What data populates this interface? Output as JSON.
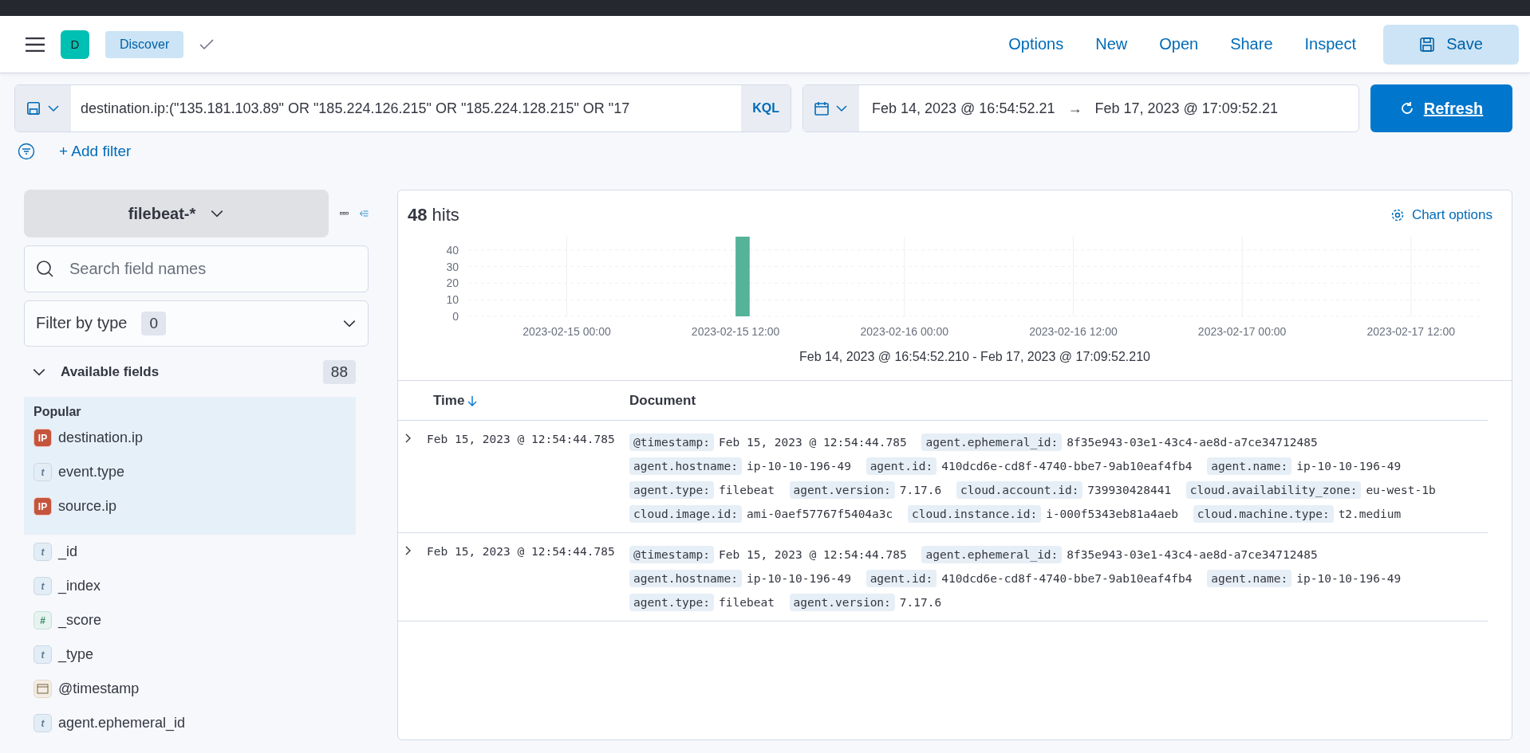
{
  "header": {
    "avatar": "D",
    "app": "Discover",
    "links": [
      "Options",
      "New",
      "Open",
      "Share",
      "Inspect"
    ],
    "save": "Save"
  },
  "query": {
    "value": "destination.ip:(\"135.181.103.89\" OR \"185.224.126.215\" OR \"185.224.128.215\" OR \"17",
    "language": "KQL",
    "start": "Feb 14, 2023 @ 16:54:52.21",
    "arrow": "→",
    "end": "Feb 17, 2023 @ 17:09:52.21",
    "refresh": "Refresh"
  },
  "add_filter": "+ Add filter",
  "sidebar": {
    "index_pattern": "filebeat-*",
    "search": {
      "placeholder": "Search field names"
    },
    "filter_label": "Filter by type",
    "filter_count": "0",
    "available_label": "Available fields",
    "available_count": "88",
    "expanded": true,
    "popular_label": "Popular",
    "popular": [
      {
        "name": "destination.ip",
        "kind": "ip",
        "token": "IP"
      },
      {
        "name": "event.type",
        "kind": "string",
        "token": "t"
      },
      {
        "name": "source.ip",
        "kind": "ip",
        "token": "IP"
      }
    ],
    "fields": [
      {
        "name": "_id",
        "kind": "string",
        "token": "t"
      },
      {
        "name": "_index",
        "kind": "string",
        "token": "t"
      },
      {
        "name": "_score",
        "kind": "number",
        "token": "#"
      },
      {
        "name": "_type",
        "kind": "string",
        "token": "t"
      },
      {
        "name": "@timestamp",
        "kind": "date"
      },
      {
        "name": "agent.ephemeral_id",
        "kind": "string",
        "token": "t"
      }
    ]
  },
  "results": {
    "hits": "48",
    "hits_label": "hits",
    "chart_options": "Chart options",
    "chart_data": {
      "type": "bar",
      "xlabel": "Feb 14, 2023 @ 16:54:52.210 - Feb 17, 2023 @ 17:09:52.210",
      "ylim": [
        0,
        48
      ],
      "grid": true,
      "categories": [
        null,
        null,
        null,
        null,
        null,
        null,
        null,
        "2023-02-15 00:00",
        null,
        null,
        null,
        null,
        null,
        null,
        null,
        null,
        null,
        null,
        null,
        "2023-02-15 12:00",
        null,
        null,
        null,
        null,
        null,
        null,
        null,
        null,
        null,
        null,
        null,
        "2023-02-16 00:00",
        null,
        null,
        null,
        null,
        null,
        null,
        null,
        null,
        null,
        null,
        null,
        "2023-02-16 12:00",
        null,
        null,
        null,
        null,
        null,
        null,
        null,
        null,
        null,
        null,
        null,
        "2023-02-17 00:00",
        null,
        null,
        null,
        null,
        null,
        null,
        null,
        null,
        null,
        null,
        null,
        "2023-02-17 12:00",
        null,
        null,
        null,
        null
      ],
      "yticks": [
        0,
        10,
        20,
        30,
        40
      ],
      "series": [
        {
          "color": "#54b399",
          "values": [
            0,
            0,
            0,
            0,
            0,
            0,
            0,
            0,
            0,
            0,
            0,
            0,
            0,
            0,
            0,
            0,
            0,
            0,
            0,
            48,
            0,
            0,
            0,
            0,
            0,
            0,
            0,
            0,
            0,
            0,
            0,
            0,
            0,
            0,
            0,
            0,
            0,
            0,
            0,
            0,
            0,
            0,
            0,
            0,
            0,
            0,
            0,
            0,
            0,
            0,
            0,
            0,
            0,
            0,
            0,
            0,
            0,
            0,
            0,
            0,
            0,
            0,
            0,
            0,
            0,
            0,
            0,
            0,
            0,
            0,
            0,
            0
          ]
        }
      ]
    },
    "columns": [
      {
        "label": "Time",
        "sorted": true
      },
      {
        "label": "Document",
        "sorted": false
      }
    ],
    "rows": [
      {
        "expanded": false,
        "time": "Feb 15, 2023 @ 12:54:44.785",
        "fields": [
          {
            "key": "@timestamp:",
            "value": "Feb 15, 2023 @ 12:54:44.785"
          },
          {
            "key": "agent.ephemeral_id:",
            "value": "8f35e943-03e1-43c4-ae8d-a7ce34712485"
          },
          {
            "key": "agent.hostname:",
            "value": "ip-10-10-196-49"
          },
          {
            "key": "agent.id:",
            "value": "410dcd6e-cd8f-4740-bbe7-9ab10eaf4fb4"
          },
          {
            "key": "agent.name:",
            "value": "ip-10-10-196-49"
          },
          {
            "key": "agent.type:",
            "value": "filebeat"
          },
          {
            "key": "agent.version:",
            "value": "7.17.6"
          },
          {
            "key": "cloud.account.id:",
            "value": "739930428441"
          },
          {
            "key": "cloud.availability_zone:",
            "value": "eu-west-1b"
          },
          {
            "key": "cloud.image.id:",
            "value": "ami-0aef57767f5404a3c"
          },
          {
            "key": "cloud.instance.id:",
            "value": "i-000f5343eb81a4aeb"
          },
          {
            "key": "cloud.machine.type:",
            "value": "t2.medium"
          }
        ]
      },
      {
        "expanded": false,
        "time": "Feb 15, 2023 @ 12:54:44.785",
        "fields": [
          {
            "key": "@timestamp:",
            "value": "Feb 15, 2023 @ 12:54:44.785"
          },
          {
            "key": "agent.ephemeral_id:",
            "value": "8f35e943-03e1-43c4-ae8d-a7ce34712485"
          },
          {
            "key": "agent.hostname:",
            "value": "ip-10-10-196-49"
          },
          {
            "key": "agent.id:",
            "value": "410dcd6e-cd8f-4740-bbe7-9ab10eaf4fb4"
          },
          {
            "key": "agent.name:",
            "value": "ip-10-10-196-49"
          },
          {
            "key": "agent.type:",
            "value": "filebeat"
          },
          {
            "key": "agent.version:",
            "value": "7.17.6"
          }
        ]
      }
    ]
  }
}
